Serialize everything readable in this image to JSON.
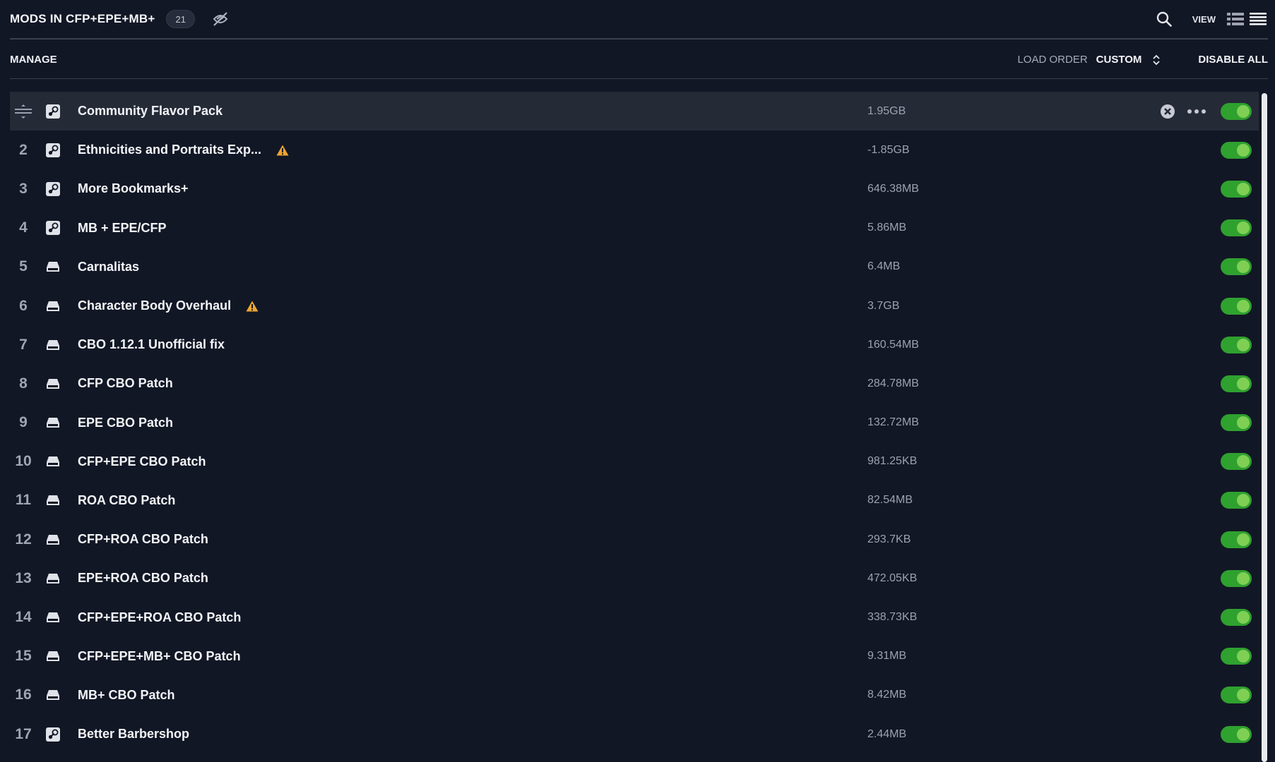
{
  "header": {
    "title": "MODS IN CFP+EPE+MB+",
    "count": "21",
    "view_label": "VIEW"
  },
  "manage_bar": {
    "manage_label": "MANAGE",
    "load_order_label": "LOAD ORDER",
    "load_order_value": "CUSTOM",
    "disable_all_label": "DISABLE ALL"
  },
  "icons": {
    "hidden": "eye-slash-icon",
    "search": "search-icon",
    "view_compact": "list-view-icon",
    "view_list": "hamburger-list-icon",
    "sort": "sort-updown-icon",
    "steam": "steam-icon",
    "local": "hard-drive-icon",
    "warning": "warning-icon",
    "remove": "close-circle-icon",
    "more": "more-dots-icon",
    "drag": "drag-handle-icon"
  },
  "colors": {
    "background": "#121725",
    "selected_row": "#252a37",
    "toggle_on": "#2fa12f",
    "warning": "#f0a52e"
  },
  "mods": [
    {
      "index": "",
      "name": "Community Flavor Pack",
      "size": "1.95GB",
      "source": "steam",
      "warning": false,
      "enabled": true,
      "selected": true
    },
    {
      "index": "2",
      "name": "Ethnicities and Portraits Exp...",
      "size": "-1.85GB",
      "source": "steam",
      "warning": true,
      "enabled": true
    },
    {
      "index": "3",
      "name": "More Bookmarks+",
      "size": "646.38MB",
      "source": "steam",
      "warning": false,
      "enabled": true
    },
    {
      "index": "4",
      "name": "MB + EPE/CFP",
      "size": "5.86MB",
      "source": "steam",
      "warning": false,
      "enabled": true
    },
    {
      "index": "5",
      "name": "Carnalitas",
      "size": "6.4MB",
      "source": "local",
      "warning": false,
      "enabled": true
    },
    {
      "index": "6",
      "name": "Character Body Overhaul",
      "size": "3.7GB",
      "source": "local",
      "warning": true,
      "enabled": true
    },
    {
      "index": "7",
      "name": "CBO 1.12.1 Unofficial fix",
      "size": "160.54MB",
      "source": "local",
      "warning": false,
      "enabled": true
    },
    {
      "index": "8",
      "name": "CFP CBO Patch",
      "size": "284.78MB",
      "source": "local",
      "warning": false,
      "enabled": true
    },
    {
      "index": "9",
      "name": "EPE CBO Patch",
      "size": "132.72MB",
      "source": "local",
      "warning": false,
      "enabled": true
    },
    {
      "index": "10",
      "name": "CFP+EPE CBO Patch",
      "size": "981.25KB",
      "source": "local",
      "warning": false,
      "enabled": true
    },
    {
      "index": "11",
      "name": "ROA CBO Patch",
      "size": "82.54MB",
      "source": "local",
      "warning": false,
      "enabled": true
    },
    {
      "index": "12",
      "name": "CFP+ROA CBO Patch",
      "size": "293.7KB",
      "source": "local",
      "warning": false,
      "enabled": true
    },
    {
      "index": "13",
      "name": "EPE+ROA CBO Patch",
      "size": "472.05KB",
      "source": "local",
      "warning": false,
      "enabled": true
    },
    {
      "index": "14",
      "name": "CFP+EPE+ROA CBO Patch",
      "size": "338.73KB",
      "source": "local",
      "warning": false,
      "enabled": true
    },
    {
      "index": "15",
      "name": "CFP+EPE+MB+ CBO Patch",
      "size": "9.31MB",
      "source": "local",
      "warning": false,
      "enabled": true
    },
    {
      "index": "16",
      "name": "MB+ CBO Patch",
      "size": "8.42MB",
      "source": "local",
      "warning": false,
      "enabled": true
    },
    {
      "index": "17",
      "name": "Better Barbershop",
      "size": "2.44MB",
      "source": "steam",
      "warning": false,
      "enabled": true
    }
  ]
}
